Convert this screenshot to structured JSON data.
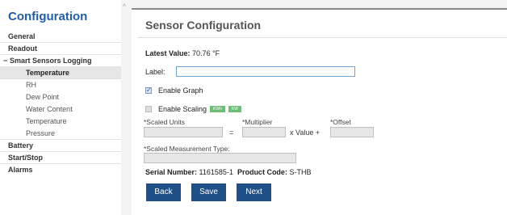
{
  "sidebar": {
    "title": "Configuration",
    "items": [
      {
        "label": "General"
      },
      {
        "label": "Readout"
      }
    ],
    "group": {
      "label": "Smart Sensors Logging",
      "expander": "−"
    },
    "sub_items": [
      {
        "label": "Temperature",
        "active": true
      },
      {
        "label": "RH"
      },
      {
        "label": "Dew Point"
      },
      {
        "label": "Water Content"
      },
      {
        "label": "Temperature"
      },
      {
        "label": "Pressure"
      }
    ],
    "items_after": [
      {
        "label": "Battery"
      },
      {
        "label": "Start/Stop"
      },
      {
        "label": "Alarms"
      }
    ],
    "scroll_caret": "˄"
  },
  "panel": {
    "title": "Sensor Configuration",
    "latest_label": "Latest Value:",
    "latest_value": "70.76 °F",
    "label_field": {
      "label": "Label:",
      "value": ""
    },
    "enable_graph": {
      "label": "Enable Graph",
      "checked": true
    },
    "enable_scaling": {
      "label": "Enable Scaling",
      "checked": false,
      "badges": [
        "KWh",
        "KW"
      ]
    },
    "scaled_units": {
      "label": "*Scaled Units",
      "value": ""
    },
    "equals": "=",
    "multiplier": {
      "label": "*Multiplier",
      "value": ""
    },
    "x_value_plus": "x Value +",
    "offset": {
      "label": "*Offset",
      "value": ""
    },
    "scaled_measurement_type": {
      "label": "*Scaled Measurement Type:",
      "value": ""
    },
    "serial_label": "Serial Number:",
    "serial_value": "1161585-1",
    "product_label": "Product Code:",
    "product_value": "S-THB",
    "buttons": {
      "back": "Back",
      "save": "Save",
      "next": "Next"
    }
  },
  "colors": {
    "accent": "#1f5fa8",
    "button": "#1e4f87",
    "badge": "#6cbf77",
    "input_border": "#6fa3d8"
  }
}
